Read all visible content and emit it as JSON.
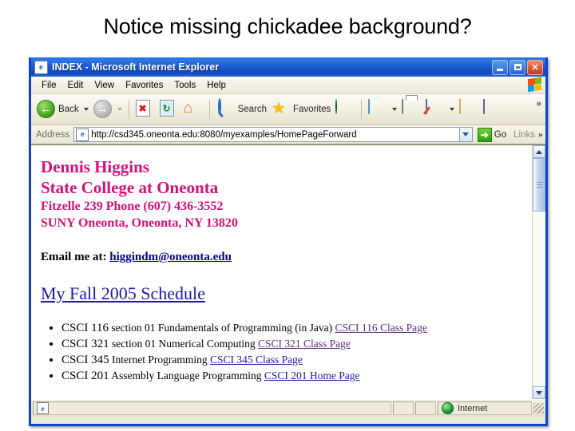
{
  "slide": {
    "title": "Notice missing chickadee background?"
  },
  "browser": {
    "title": "INDEX - Microsoft Internet Explorer",
    "title_icon": "ie-document-icon",
    "window_controls": {
      "minimize": "Minimize",
      "maximize": "Maximize",
      "close": "Close"
    },
    "menu": [
      {
        "label": "File",
        "accel": "F"
      },
      {
        "label": "Edit",
        "accel": "E"
      },
      {
        "label": "View",
        "accel": "V"
      },
      {
        "label": "Favorites",
        "accel": "a"
      },
      {
        "label": "Tools",
        "accel": "T"
      },
      {
        "label": "Help",
        "accel": "H"
      }
    ],
    "toolbar": {
      "back_label": "Back",
      "forward_label": "Forward",
      "stop_label": "Stop",
      "refresh_label": "Refresh",
      "home_label": "Home",
      "search_label": "Search",
      "favorites_label": "Favorites",
      "media_label": "Media",
      "mail_label": "Mail",
      "print_label": "Print",
      "edit_label": "Edit",
      "notes_label": "Notes",
      "research_label": "Research",
      "overflow_label": "»"
    },
    "address": {
      "label": "Address",
      "url": "http://csd345.oneonta.edu:8080/myexamples/HomePageForward",
      "go_label": "Go",
      "go_glyph": "➔",
      "links_label": "Links",
      "overflow_label": "»"
    },
    "statusbar": {
      "message": "",
      "zone": "Internet"
    }
  },
  "page": {
    "name_line": "Dennis Higgins",
    "school_line": "State College at Oneonta",
    "office_line": "Fitzelle 239    Phone (607) 436-3552",
    "address_line": "SUNY Oneonta, Oneonta, NY 13820",
    "email_prefix": "Email me at: ",
    "email_link": "higgindm@oneonta.edu",
    "schedule_heading": "My Fall 2005 Schedule",
    "courses": [
      {
        "code": "CSCI 116",
        "desc": " section 01 Fundamentals of Programming (in Java)  ",
        "link": "CSCI 116 Class Page",
        "link_state": "visited"
      },
      {
        "code": "CSCI 321",
        "desc": " section 01 Numerical Computing ",
        "link": "CSCI 321 Class Page",
        "link_state": "visited"
      },
      {
        "code": "CSCI 345",
        "desc": " Internet Programming  ",
        "link": "CSCI 345 Class Page",
        "link_state": "unvisited"
      },
      {
        "code": "CSCI 201",
        "desc": " Assembly Language Programming  ",
        "link": "CSCI 201 Home Page",
        "link_state": "unvisited"
      }
    ]
  },
  "colors": {
    "heading_pink": "#d1127a",
    "link_blue": "#1b1b9e",
    "link_visited": "#5a2d7a",
    "titlebar_blue": "#1b5bd4"
  }
}
